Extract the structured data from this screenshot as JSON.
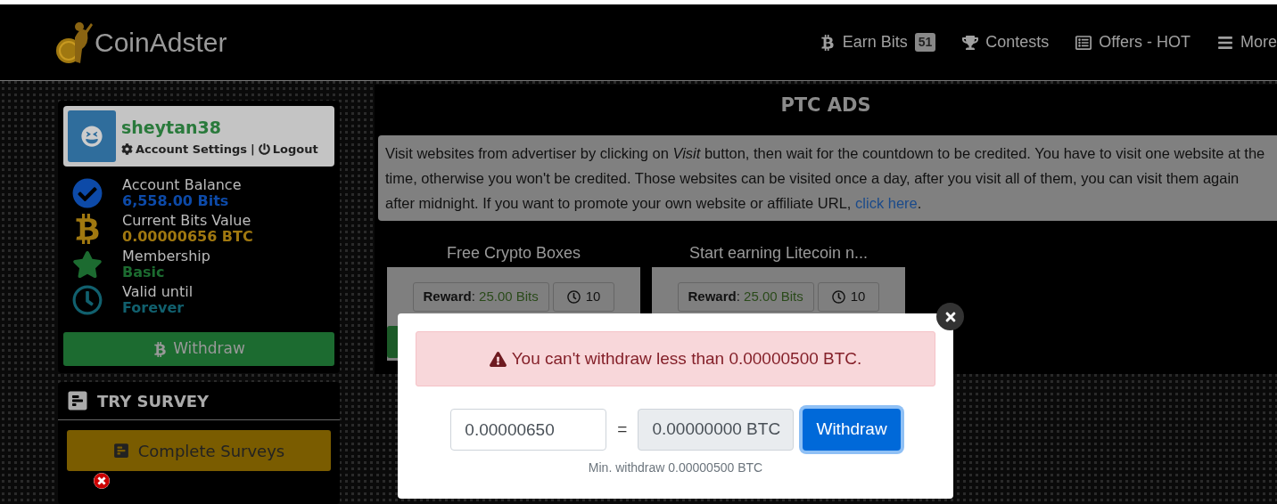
{
  "header": {
    "logo": "CoinAdster",
    "nav": [
      {
        "kind": "bits",
        "label": "Earn Bits",
        "badge": "51"
      },
      {
        "kind": "contests",
        "label": "Contests"
      },
      {
        "kind": "offers",
        "label": "Offers - HOT"
      },
      {
        "kind": "more",
        "label": "More"
      }
    ]
  },
  "profile": {
    "username": "sheytan38",
    "settings": "Account Settings",
    "separator": "|",
    "logout": "Logout"
  },
  "stats": [
    {
      "kind": "balance",
      "label": "Account Balance",
      "value": "6,558.00 Bits"
    },
    {
      "kind": "bits",
      "label": "Current Bits Value",
      "value": "0.00000656 BTC"
    },
    {
      "kind": "membership",
      "label": "Membership",
      "value": "Basic"
    },
    {
      "kind": "valid",
      "label": "Valid until",
      "value": "Forever"
    }
  ],
  "withdraw_button": "Withdraw",
  "survey": {
    "title": "TRY SURVEY",
    "button": "Complete Surveys"
  },
  "ptc": {
    "title": "PTC ADS",
    "info": "Visit websites from advertiser by clicking on *Visit* button, then wait for the countdown to be credited. You have to visit one website at the time, otherwise you won't be credited. Those websites can be visited once a day, after you visit all of them, you can visit them again after midnight. If you want to promote your own website or affiliate URL,",
    "info_link": "click here",
    "info_end": ".",
    "ads": [
      {
        "title": "Free Crypto Boxes",
        "reward_label": "**Reward**:",
        "reward": "25.00 Bits",
        "time": "10",
        "visit_button_visible": true
      },
      {
        "title": "Start earning Litecoin n...",
        "reward_label": "**Reward**:",
        "reward": "25.00 Bits",
        "time": "10"
      }
    ]
  },
  "modal": {
    "alert": "You can't withdraw less than 0.00000500 BTC.",
    "amount": "0.00000650",
    "equals": "=",
    "btc": "0.00000000 BTC",
    "button": "Withdraw",
    "hint": "Min. withdraw 0.00000500 BTC"
  }
}
